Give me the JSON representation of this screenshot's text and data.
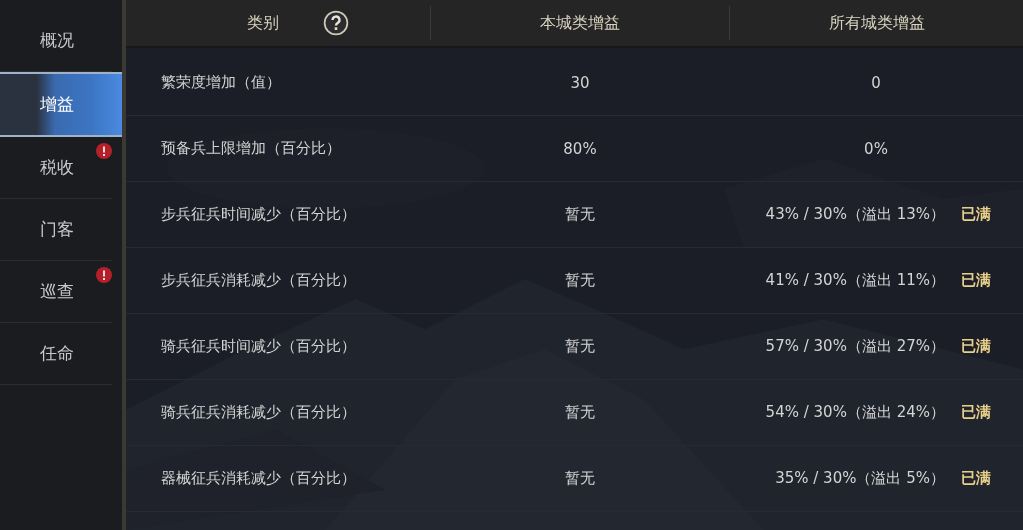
{
  "sidebar": {
    "items": [
      {
        "label": "概况",
        "selected": false,
        "alert": false
      },
      {
        "label": "增益",
        "selected": true,
        "alert": false
      },
      {
        "label": "税收",
        "selected": false,
        "alert": true
      },
      {
        "label": "门客",
        "selected": false,
        "alert": false
      },
      {
        "label": "巡查",
        "selected": false,
        "alert": true
      },
      {
        "label": "任命",
        "selected": false,
        "alert": false
      }
    ]
  },
  "table": {
    "columns": [
      {
        "label": "类别",
        "help": true
      },
      {
        "label": "本城类增益"
      },
      {
        "label": "所有城类增益"
      }
    ],
    "rows": [
      {
        "category": "繁荣度增加（值）",
        "city": "30",
        "all": "0"
      },
      {
        "category": "预备兵上限增加（百分比）",
        "city": "80%",
        "all": "0%"
      },
      {
        "category": "步兵征兵时间减少（百分比）",
        "city": "暂无",
        "all": "43% / 30%（溢出 13%）",
        "status": "已满"
      },
      {
        "category": "步兵征兵消耗减少（百分比）",
        "city": "暂无",
        "all": "41% / 30%（溢出 11%）",
        "status": "已满"
      },
      {
        "category": "骑兵征兵时间减少（百分比）",
        "city": "暂无",
        "all": "57% / 30%（溢出 27%）",
        "status": "已满"
      },
      {
        "category": "骑兵征兵消耗减少（百分比）",
        "city": "暂无",
        "all": "54% / 30%（溢出 24%）",
        "status": "已满"
      },
      {
        "category": "器械征兵消耗减少（百分比）",
        "city": "暂无",
        "all": "35% / 30%（溢出 5%）",
        "status": "已满"
      }
    ]
  }
}
